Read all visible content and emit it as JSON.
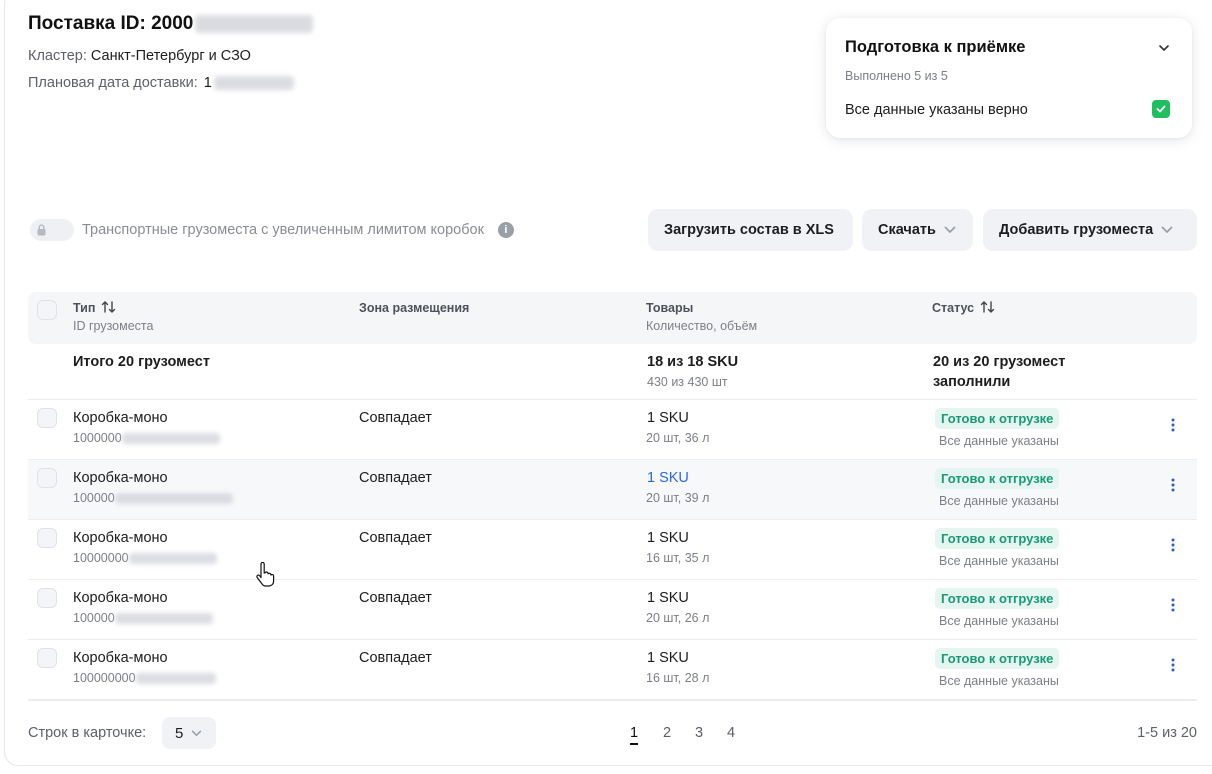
{
  "header": {
    "title_prefix": "Поставка ID: 2000",
    "cluster_label": "Кластер:",
    "cluster_value": "Санкт-Петербург и СЗО",
    "date_label": "Плановая дата доставки:",
    "date_value_prefix": "1"
  },
  "prep": {
    "title": "Подготовка к приёмке",
    "progress": "Выполнено 5 из 5",
    "status": "Все данные указаны верно",
    "accent": "#1fbf5f"
  },
  "toolbar": {
    "toggle_label": "Транспортные грузоместа с увеличенным лимитом коробок",
    "info_glyph": "i",
    "upload_label": "Загрузить состав в XLS",
    "download_label": "Скачать",
    "add_label": "Добавить грузоместа"
  },
  "table": {
    "col_type": "Тип",
    "col_type_sub": "ID грузоместа",
    "col_zone": "Зона размещения",
    "col_goods": "Товары",
    "col_goods_sub": "Количество, объём",
    "col_status": "Статус",
    "total": {
      "label": "Итого 20 грузомест",
      "goods": "18 из 18 SKU",
      "goods_sub": "430 из 430 шт",
      "status_line1": "20 из 20 грузомест",
      "status_line2": "заполнили"
    },
    "rows": [
      {
        "type": "Коробка-моно",
        "id_prefix": "1000000",
        "zone": "Совпадает",
        "goods": "1 SKU",
        "goods_sub": "20 шт, 36 л",
        "status": "Готово к отгрузке",
        "status_sub": "Все данные указаны"
      },
      {
        "type": "Коробка-моно",
        "id_prefix": "100000",
        "zone": "Совпадает",
        "goods": "1 SKU",
        "goods_sub": "20 шт, 39 л",
        "status": "Готово к отгрузке",
        "status_sub": "Все данные указаны"
      },
      {
        "type": "Коробка-моно",
        "id_prefix": "10000000",
        "zone": "Совпадает",
        "goods": "1 SKU",
        "goods_sub": "16 шт, 35 л",
        "status": "Готово к отгрузке",
        "status_sub": "Все данные указаны"
      },
      {
        "type": "Коробка-моно",
        "id_prefix": "100000",
        "zone": "Совпадает",
        "goods": "1 SKU",
        "goods_sub": "20 шт, 26 л",
        "status": "Готово к отгрузке",
        "status_sub": "Все данные указаны"
      },
      {
        "type": "Коробка-моно",
        "id_prefix": "100000000",
        "zone": "Совпадает",
        "goods": "1 SKU",
        "goods_sub": "16 шт, 28 л",
        "status": "Готово к отгрузке",
        "status_sub": "Все данные указаны"
      }
    ]
  },
  "footer": {
    "rows_label": "Строк в карточке:",
    "rows_value": "5",
    "pages": [
      "1",
      "2",
      "3",
      "4"
    ],
    "active_page": "1",
    "range": "1-5 из 20"
  },
  "colors": {
    "status_bg": "#e4f6ef",
    "status_fg": "#1a9a77",
    "link": "#2a6ad8"
  }
}
